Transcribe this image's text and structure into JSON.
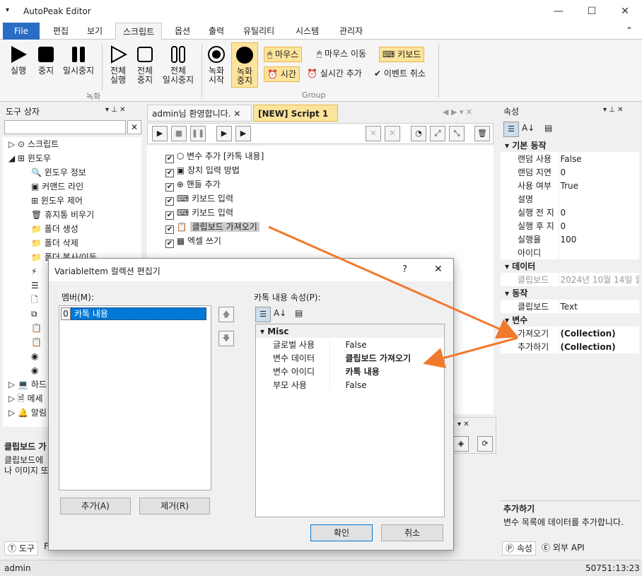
{
  "app": {
    "title": "AutoPeak Editor",
    "min": "—",
    "max": "☐",
    "close": "✕",
    "collapse": "⌃",
    "win_icon": "▾"
  },
  "menu": [
    "File",
    "편집",
    "보기",
    "스크립트",
    "옵션",
    "출력",
    "유틸리티",
    "시스템",
    "관리자"
  ],
  "ribbon": {
    "run": "실행",
    "stop": "중지",
    "pause": "일시중지",
    "all_run": [
      "전체",
      "실행"
    ],
    "all_stop": [
      "전체",
      "중지"
    ],
    "all_pause": [
      "전체",
      "일시중지"
    ],
    "rec_start": [
      "녹화",
      "시작"
    ],
    "rec_stop": [
      "녹화",
      "중지"
    ],
    "group_rec": "녹화",
    "group_group": "Group",
    "mouse": "마우스",
    "mouse_move": "마우스 이동",
    "keyboard": "키보드",
    "time": "시간",
    "realtime_add": "실시간 추가",
    "event_cancel": "이벤트 취소"
  },
  "toolbox": {
    "title": "도구 상자",
    "items": [
      "스크립트",
      "윈도우",
      "윈도우 정보",
      "커맨드 라인",
      "윈도우 제어",
      "휴지통 비우기",
      "폴더 생성",
      "폴더 삭제",
      "폴더 복사/이동",
      "하드",
      "메세",
      "알림"
    ],
    "desc_title": "클립보드 가",
    "desc_line1": "클립보드에",
    "desc_line2": "나 이미지 또",
    "tab_tool": "도구",
    "tab_f": "F"
  },
  "doc": {
    "tab1": "admin님 환영합니다.",
    "tab2": "[NEW] Script 1",
    "lines": [
      "변수 추가 [카톡 내용]",
      "장치 입력 방법",
      "핸들 추가",
      "키보드 입력",
      "키보드 입력",
      "클립보드 가져오기",
      "엑셀 쓰기"
    ]
  },
  "props": {
    "title": "속성",
    "cat1": "기본 동작",
    "rows1": [
      [
        "랜덤 사용",
        "False"
      ],
      [
        "랜덤 지연",
        "0"
      ],
      [
        "사용 여부",
        "True"
      ],
      [
        "설명",
        ""
      ],
      [
        "실행 전 지",
        "0"
      ],
      [
        "실행 후 지",
        "0"
      ],
      [
        "실행율",
        "100"
      ],
      [
        "아이디",
        ""
      ]
    ],
    "cat2": "데이터",
    "rows2": [
      [
        "클립보드",
        "2024년 10월 14일 월"
      ]
    ],
    "cat3": "동작",
    "rows3": [
      [
        "클립보드",
        "Text"
      ]
    ],
    "cat4": "변수",
    "rows4": [
      [
        "가져오기",
        "(Collection)"
      ],
      [
        "추가하기",
        "(Collection)"
      ]
    ],
    "desc_title": "추가하기",
    "desc_text": "변수 목록에 데이터를 추가합니다.",
    "tab_props": "속성",
    "tab_api": "외부 API"
  },
  "dialog": {
    "title": "VariableItem 컬렉션 편집기",
    "help": "?",
    "close": "✕",
    "members_label": "멤버(M):",
    "member_index": "0",
    "member_name": "카톡 내용",
    "props_label": "카톡 내용 속성(P):",
    "cat": "Misc",
    "rows": [
      [
        "글로벌 사용",
        "False"
      ],
      [
        "변수 데이터",
        "클립보드 가져오기"
      ],
      [
        "변수 아이디",
        "카톡 내용"
      ],
      [
        "부모 사용",
        "False"
      ]
    ],
    "add": "추가(A)",
    "remove": "제거(R)",
    "ok": "확인",
    "cancel": "취소"
  },
  "status": {
    "user": "admin",
    "time": "50751:13:23"
  },
  "colors": {
    "accent": "#2b6cc4",
    "highlight": "#fde49b",
    "arrow": "#f07a2c"
  }
}
